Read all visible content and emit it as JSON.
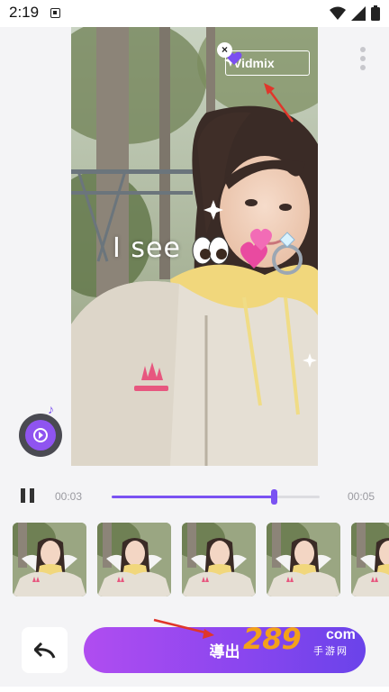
{
  "status_bar": {
    "time": "2:19"
  },
  "video": {
    "sticker_text": "I see",
    "watermark": {
      "label": "Vidmix"
    }
  },
  "playback": {
    "current_time": "00:03",
    "total_time": "00:05",
    "progress": 0.78
  },
  "thumbnails": {
    "count": 5
  },
  "actions": {
    "export_label": "導出"
  },
  "brand_mark": {
    "digits": "289",
    "suffix": "com",
    "sub": "手游网"
  },
  "colors": {
    "accent": "#7a52f2",
    "export_gradient_start": "#b04df0",
    "export_gradient_end": "#6a43ea",
    "brand_orange": "#f3a11a",
    "annotation_red": "#e0362b"
  },
  "icons": {
    "pause": "pause-icon",
    "undo": "undo-icon",
    "close": "close-icon",
    "more": "more-vertical-icon",
    "music": "music-note-icon",
    "heart": "heart-icon",
    "wifi": "wifi-icon",
    "signal": "signal-icon",
    "battery": "battery-icon"
  }
}
